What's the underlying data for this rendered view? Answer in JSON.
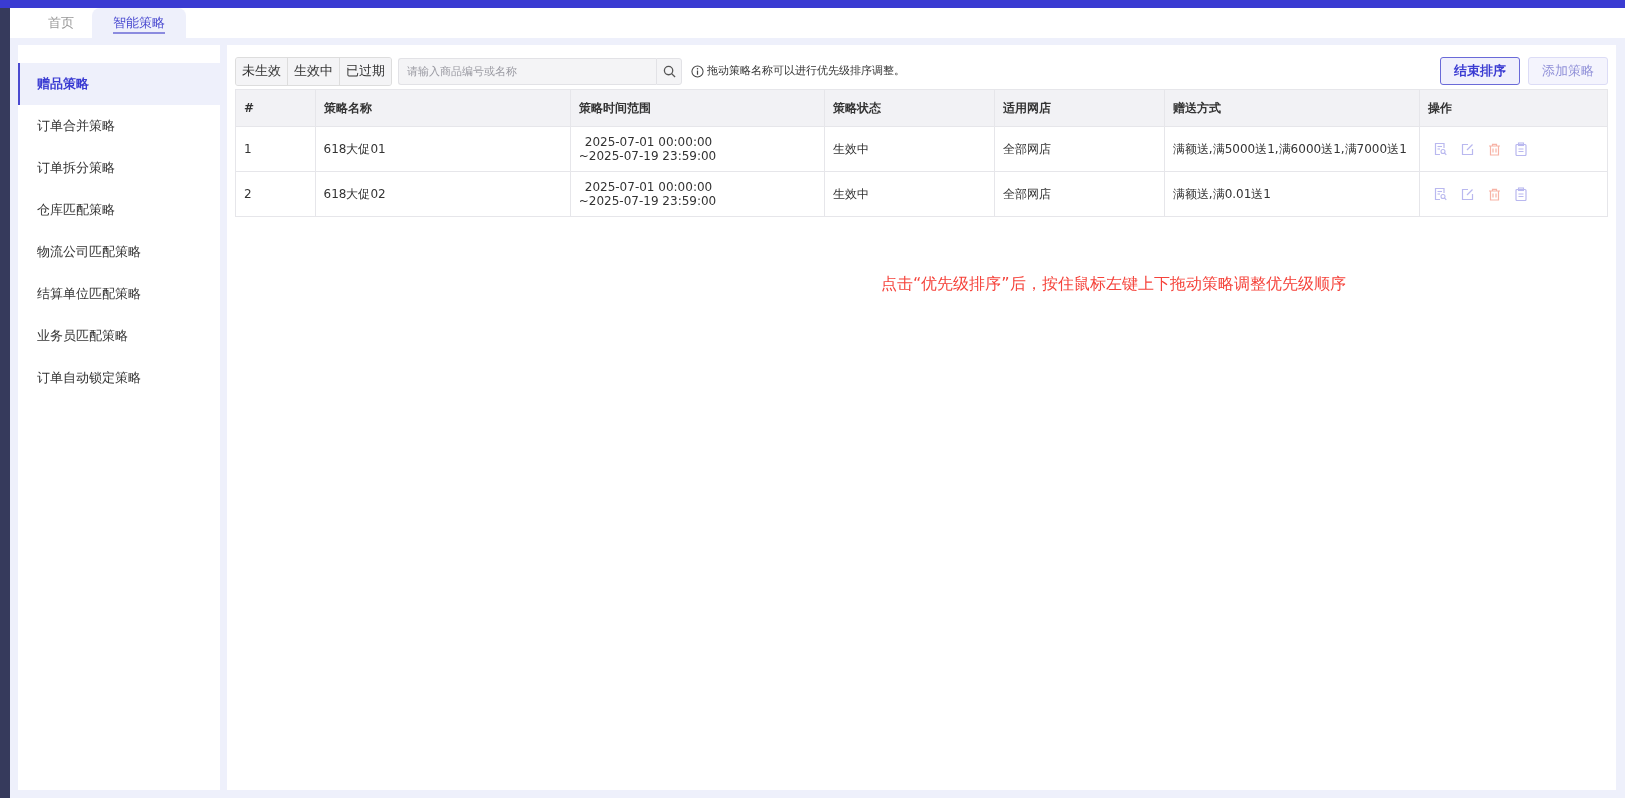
{
  "tabs": [
    {
      "label": "首页",
      "selected": false
    },
    {
      "label": "智能策略",
      "selected": true
    }
  ],
  "sidebar": {
    "items": [
      {
        "label": "赠品策略",
        "selected": true
      },
      {
        "label": "订单合并策略",
        "selected": false
      },
      {
        "label": "订单拆分策略",
        "selected": false
      },
      {
        "label": "仓库匹配策略",
        "selected": false
      },
      {
        "label": "物流公司匹配策略",
        "selected": false
      },
      {
        "label": "结算单位匹配策略",
        "selected": false
      },
      {
        "label": "业务员匹配策略",
        "selected": false
      },
      {
        "label": "订单自动锁定策略",
        "selected": false
      }
    ]
  },
  "filters": [
    {
      "label": "未生效",
      "selected": false
    },
    {
      "label": "生效中",
      "selected": false
    },
    {
      "label": "已过期",
      "selected": false
    }
  ],
  "search": {
    "placeholder": "请输入商品编号或名称"
  },
  "hint": "拖动策略名称可以进行优先级排序调整。",
  "buttons": [
    {
      "label": "结束排序",
      "disabled": false
    },
    {
      "label": "添加策略",
      "disabled": true
    }
  ],
  "table": {
    "columns": [
      "#",
      "策略名称",
      "策略时间范围",
      "策略状态",
      "适用网店",
      "赠送方式",
      "操作"
    ],
    "rows": [
      {
        "index": "1",
        "name": "618大促01",
        "start": "2025-07-01 00:00:00",
        "end": "~2025-07-19 23:59:00",
        "status": "生效中",
        "shop": "全部网店",
        "gift": "满额送,满5000送1,满6000送1,满7000送1"
      },
      {
        "index": "2",
        "name": "618大促02",
        "start": "2025-07-01 00:00:00",
        "end": "~2025-07-19 23:59:00",
        "status": "生效中",
        "shop": "全部网店",
        "gift": "满额送,满0.01送1"
      }
    ]
  },
  "annotation": "点击“优先级排序”后，按住鼠标左键上下拖动策略调整优先级顺序"
}
